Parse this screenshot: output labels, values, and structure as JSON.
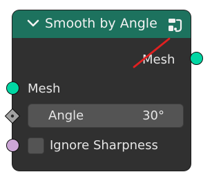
{
  "node": {
    "title": "Smooth by Angle",
    "collapse_icon": "chevron-down-icon",
    "header_icon": "modifier-icon",
    "header_color": "#1d725e",
    "outputs": [
      {
        "label": "Mesh",
        "socket_color": "#00d6a3"
      }
    ],
    "inputs": {
      "mesh": {
        "label": "Mesh",
        "socket_color": "#00d6a3"
      },
      "angle": {
        "label": "Angle",
        "value": "30°",
        "socket_color": "#a1a1a1"
      },
      "ignore_sharpness": {
        "label": "Ignore Sharpness",
        "checked": false,
        "socket_color": "#cca6d6"
      }
    }
  },
  "annotation": {
    "color": "#e02020"
  }
}
